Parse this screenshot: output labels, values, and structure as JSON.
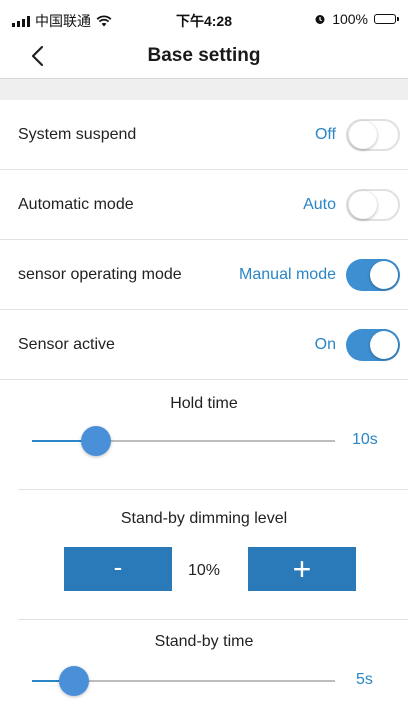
{
  "status_bar": {
    "carrier": "中国联通",
    "time": "下午4:28",
    "battery": "100%",
    "battery_level": 1.0,
    "icons": [
      "signal-icon",
      "wifi-icon",
      "alarm-icon",
      "battery-icon"
    ]
  },
  "nav": {
    "title": "Base setting",
    "back_icon": "chevron-left-icon"
  },
  "settings": [
    {
      "label": "System suspend",
      "value": "Off",
      "enabled": false
    },
    {
      "label": "Automatic mode",
      "value": "Auto",
      "enabled": false
    },
    {
      "label": "sensor operating mode",
      "value": "Manual mode",
      "enabled": true
    },
    {
      "label": "Sensor active",
      "value": "On",
      "enabled": true
    }
  ],
  "hold_time": {
    "title": "Hold time",
    "value": "10s",
    "position": 0.21
  },
  "dimming": {
    "title": "Stand-by dimming level",
    "value": "10%",
    "minus_label": "-",
    "plus_label": "+"
  },
  "standby_time": {
    "title": "Stand-by time",
    "value": "5s",
    "position": 0.14
  },
  "colors": {
    "accent": "#2a86c6",
    "toggle_on": "#3d8fd2",
    "button": "#2a79b8"
  }
}
